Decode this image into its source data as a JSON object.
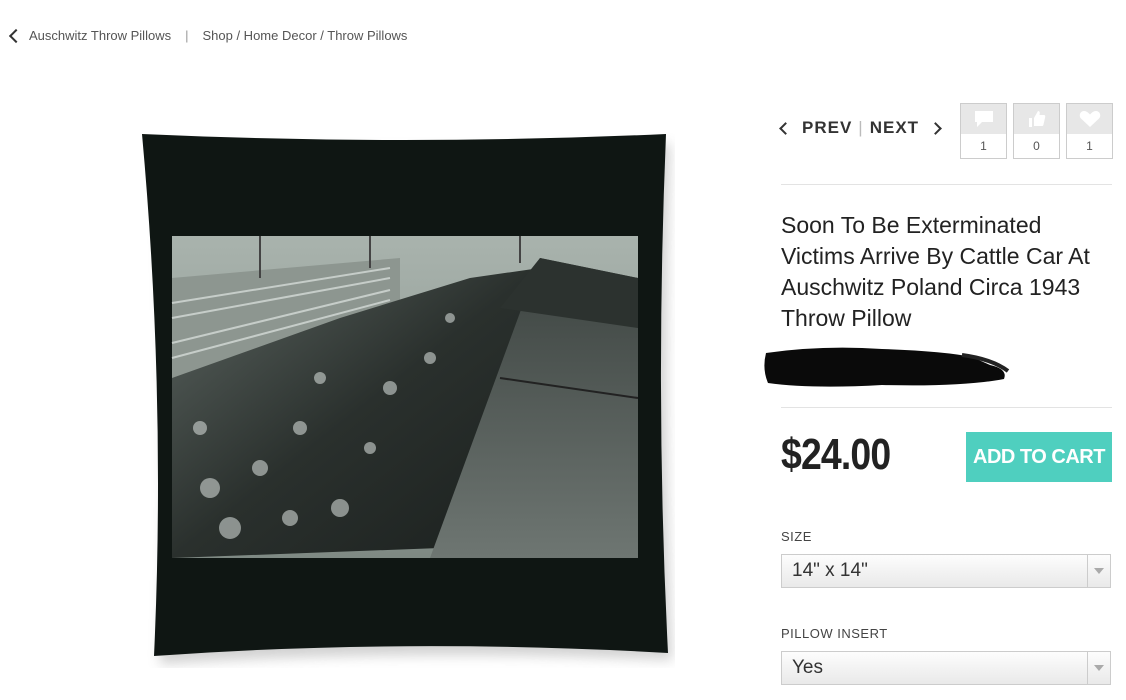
{
  "breadcrumb": {
    "back_label": "Auschwitz Throw Pillows",
    "separator": "|",
    "path": "Shop / Home Decor / Throw Pillows"
  },
  "pager": {
    "prev_label": "PREV",
    "divider": "|",
    "next_label": "NEXT"
  },
  "counters": [
    {
      "icon": "comment-icon",
      "count": "1"
    },
    {
      "icon": "thumbs-up-icon",
      "count": "0"
    },
    {
      "icon": "heart-icon",
      "count": "1"
    }
  ],
  "product": {
    "title": "Soon To Be Exterminated Victims Arrive By Cattle Car At Auschwitz Poland Circa 1943 Throw Pillow",
    "price": "$24.00",
    "add_to_cart_label": "ADD TO CART"
  },
  "options": {
    "size_label": "SIZE",
    "size_value": "14\" x 14\"",
    "insert_label": "PILLOW INSERT",
    "insert_value": "Yes"
  },
  "colors": {
    "accent": "#4fcfbf",
    "pillow": "#0f1613"
  }
}
